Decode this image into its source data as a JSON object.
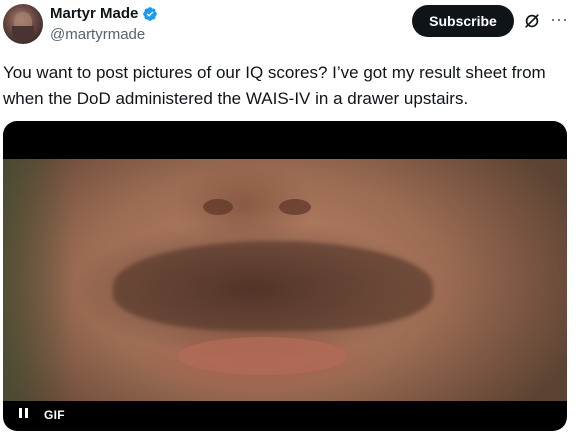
{
  "author": {
    "display_name": "Martyr Made",
    "handle": "@martyrmade",
    "verified_icon": "verified-badge-icon"
  },
  "actions": {
    "subscribe_label": "Subscribe",
    "grok_icon": "grok-icon",
    "more_icon": "more-dots-icon",
    "more_glyph": "···"
  },
  "tweet": {
    "text": "You want to post pictures of our IQ scores? I’ve got my result sheet from when the DoD administered the WAIS-IV in a drawer upstairs."
  },
  "media": {
    "type_label": "GIF",
    "pause_icon": "pause-icon"
  },
  "colors": {
    "accent_blue": "#1d9bf0",
    "text_primary": "#0f1419",
    "text_secondary": "#536471"
  }
}
